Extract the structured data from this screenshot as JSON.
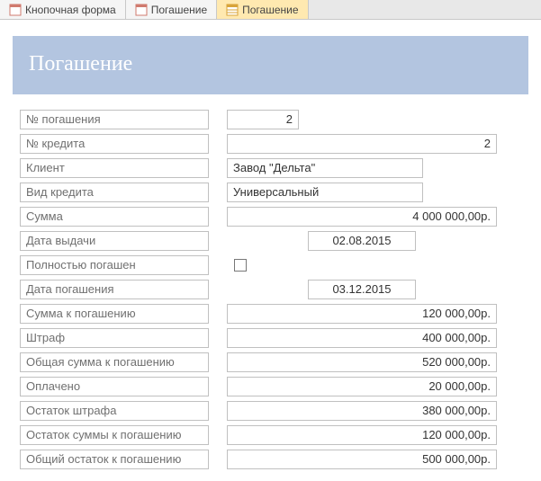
{
  "tabs": [
    {
      "label": "Кнопочная форма",
      "active": false,
      "icon": "form-icon"
    },
    {
      "label": "Погашение",
      "active": false,
      "icon": "form-icon"
    },
    {
      "label": "Погашение",
      "active": true,
      "icon": "table-icon"
    }
  ],
  "header": {
    "title": "Погашение"
  },
  "fields": {
    "repayment_no": {
      "label": "№ погашения",
      "value": "2"
    },
    "credit_no": {
      "label": "№ кредита",
      "value": "2"
    },
    "client": {
      "label": "Клиент",
      "value": "Завод \"Дельта\""
    },
    "credit_type": {
      "label": "Вид кредита",
      "value": "Универсальный"
    },
    "amount": {
      "label": "Сумма",
      "value": "4 000 000,00р."
    },
    "issue_date": {
      "label": "Дата выдачи",
      "value": "02.08.2015"
    },
    "fully_repaid": {
      "label": "Полностью погашен",
      "checked": false
    },
    "repay_date": {
      "label": "Дата погашения",
      "value": "03.12.2015"
    },
    "amount_due": {
      "label": "Сумма к погашению",
      "value": "120 000,00р."
    },
    "penalty": {
      "label": "Штраф",
      "value": "400 000,00р."
    },
    "total_due": {
      "label": "Общая сумма к погашению",
      "value": "520 000,00р."
    },
    "paid": {
      "label": "Оплачено",
      "value": "20 000,00р."
    },
    "penalty_left": {
      "label": "Остаток штрафа",
      "value": "380 000,00р."
    },
    "amount_left": {
      "label": "Остаток суммы к погашению",
      "value": "120 000,00р."
    },
    "total_left": {
      "label": "Общий остаток к погашению",
      "value": "500 000,00р."
    }
  }
}
